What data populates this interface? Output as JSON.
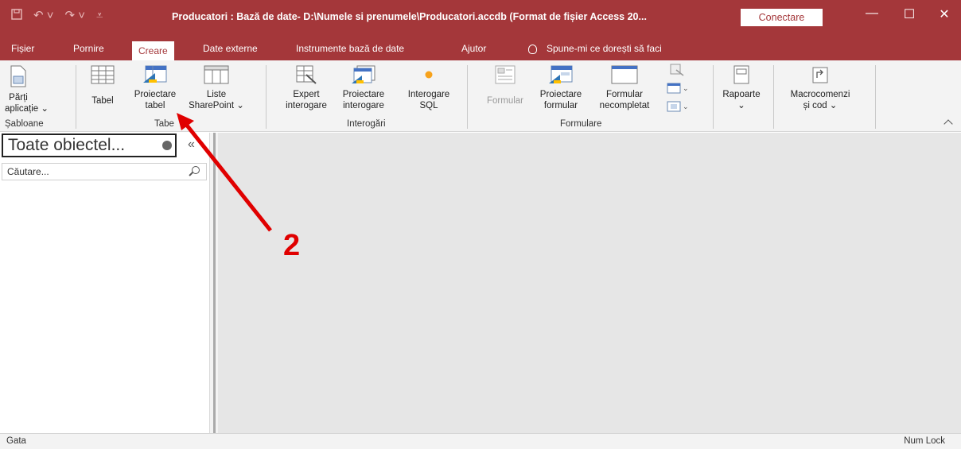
{
  "titlebar": {
    "title": "Producatori : Bază de date- D:\\Numele si prenumele\\Producatori.accdb (Format de fișier Access 20...",
    "connect_label": "Conectare"
  },
  "tabs": [
    {
      "label": "Fișier"
    },
    {
      "label": "Pornire"
    },
    {
      "label": "Creare"
    },
    {
      "label": "Date externe"
    },
    {
      "label": "Instrumente bază de date"
    },
    {
      "label": "Ajutor"
    }
  ],
  "tell_me": "Spune-mi ce dorești să faci",
  "ribbon": {
    "parts_line1": "Părți",
    "parts_line2": "aplicație ⌄",
    "templates_group": "Șabloane",
    "table": "Tabel",
    "table_design_line1": "Proiectare",
    "table_design_line2": "tabel",
    "sharepoint_line1": "Liste",
    "sharepoint_line2": "SharePoint ⌄",
    "tables_group": "Tabe",
    "query_wizard_line1": "Expert",
    "query_wizard_line2": "interogare",
    "query_design_line1": "Proiectare",
    "query_design_line2": "interogare",
    "sql_line1": "Interogare",
    "sql_line2": "SQL",
    "queries_group": "Interogări",
    "form": "Formular",
    "form_design_line1": "Proiectare",
    "form_design_line2": "formular",
    "blank_form_line1": "Formular",
    "blank_form_line2": "necompletat",
    "forms_group": "Formulare",
    "reports_line1": "Rapoarte",
    "reports_line2": "⌄",
    "macros_line1": "Macrocomenzi",
    "macros_line2": "și cod ⌄"
  },
  "nav": {
    "header": "Toate obiectel...",
    "search_placeholder": "Căutare..."
  },
  "status": {
    "left": "Gata",
    "right": "Num Lock"
  },
  "annotation": {
    "number": "2",
    "color": "#e00000"
  },
  "colors": {
    "accent": "#a4373a"
  }
}
